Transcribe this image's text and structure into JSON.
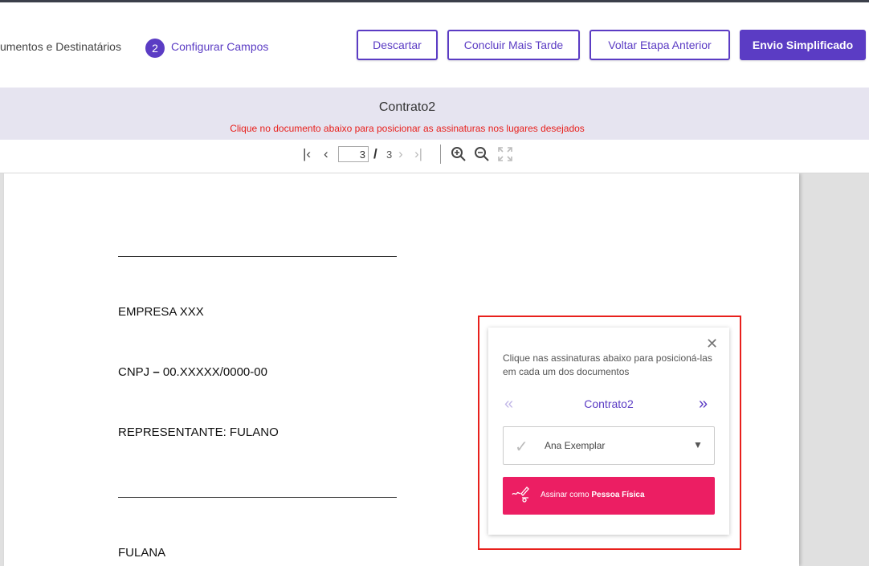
{
  "header": {
    "step1_label": "umentos e Destinatários",
    "step2_number": "2",
    "step2_label": "Configurar Campos",
    "buttons": {
      "discard": "Descartar",
      "finish_later": "Concluir Mais Tarde",
      "previous_step": "Voltar Etapa Anterior",
      "simplified_send": "Envio Simplificado"
    }
  },
  "document_bar": {
    "title": "Contrato2",
    "instruction": "Clique no documento abaixo para posicionar as assinaturas nos lugares desejados"
  },
  "toolbar": {
    "current_page": "3",
    "separator": "/",
    "total_pages": "3",
    "icons": [
      "first-page-icon",
      "previous-page-icon",
      "next-page-icon",
      "last-page-icon",
      "zoom-in-icon",
      "zoom-out-icon",
      "fullscreen-icon"
    ]
  },
  "document": {
    "lines": {
      "company": "EMPRESA XXX",
      "cnpj_prefix": "CNPJ ",
      "cnpj_dash": "–",
      "cnpj_value": " 00.XXXXX/0000-00",
      "representative": "REPRESENTANTE: FULANO",
      "second_signer": "FULANA"
    }
  },
  "signature_panel": {
    "instruction": "Clique nas assinaturas abaixo para posicioná-las em cada um dos documentos",
    "document_name": "Contrato2",
    "signer_name": "Ana Exemplar",
    "sign_button_prefix": "Assinar como ",
    "sign_button_bold": "Pessoa Física"
  },
  "colors": {
    "accent": "#5b3cc4",
    "instruction_red": "#e8201c",
    "sign_button": "#ec1e63",
    "document_bar_bg": "#e6e4f0"
  }
}
